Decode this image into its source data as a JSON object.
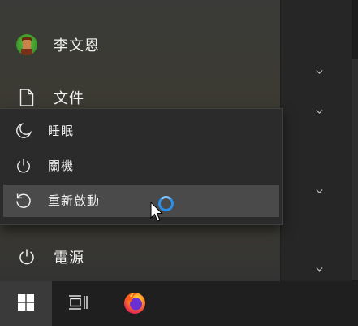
{
  "start_menu": {
    "user": {
      "name": "李文恩",
      "icon": "user-avatar-icon"
    },
    "documents": {
      "label": "文件",
      "icon": "document-icon"
    },
    "power": {
      "label": "電源",
      "icon": "power-icon"
    }
  },
  "power_menu": {
    "items": [
      {
        "label": "睡眠",
        "icon": "sleep-moon-icon"
      },
      {
        "label": "關機",
        "icon": "power-icon"
      },
      {
        "label": "重新啟動",
        "icon": "restart-icon",
        "hovered": true
      }
    ]
  },
  "taskbar": {
    "items": [
      {
        "name": "start",
        "icon": "windows-logo-icon"
      },
      {
        "name": "task-view",
        "icon": "task-view-icon"
      },
      {
        "name": "firefox",
        "icon": "firefox-icon"
      }
    ]
  },
  "colors": {
    "accent": "#2b8fe8",
    "menu_bg": "#2b2b2b",
    "hover_bg": "#4a4a4a",
    "taskbar_bg": "#1f1f1f"
  }
}
